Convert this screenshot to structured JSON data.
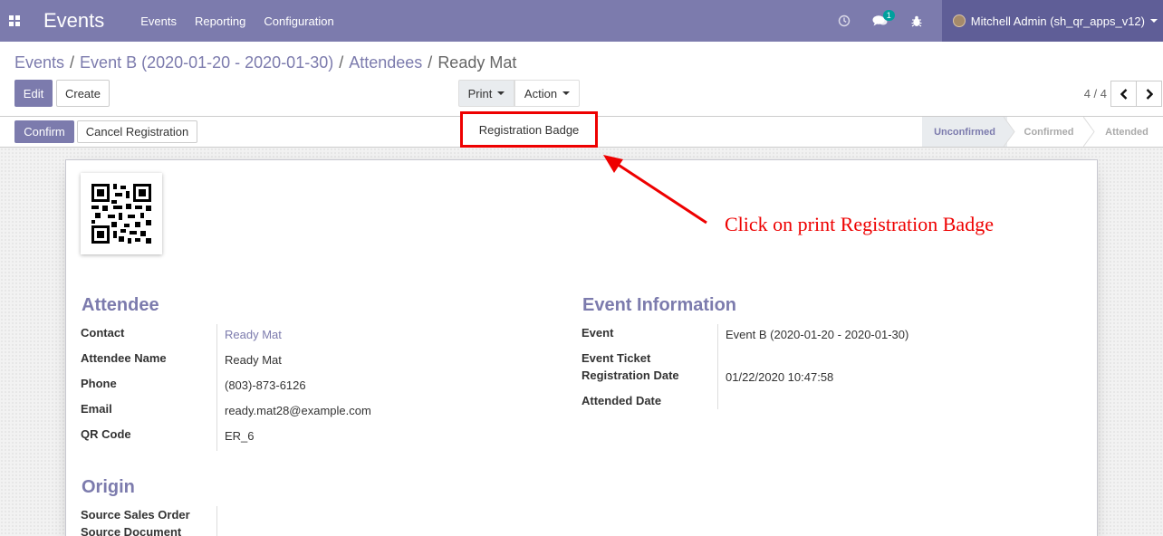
{
  "navbar": {
    "brand": "Events",
    "menu": [
      "Events",
      "Reporting",
      "Configuration"
    ],
    "chat_count": "1",
    "user": "Mitchell Admin (sh_qr_apps_v12)",
    "accent": "#7c7bad"
  },
  "breadcrumb": {
    "items": [
      "Events",
      "Event B (2020-01-20 - 2020-01-30)",
      "Attendees"
    ],
    "current": "Ready Mat"
  },
  "toolbar": {
    "edit": "Edit",
    "create": "Create",
    "print": "Print",
    "action": "Action",
    "pager": "4 / 4"
  },
  "print_menu": {
    "item": "Registration Badge"
  },
  "statusbar": {
    "confirm": "Confirm",
    "cancel": "Cancel Registration",
    "stages": [
      "Unconfirmed",
      "Confirmed",
      "Attended"
    ],
    "current_stage": "Unconfirmed"
  },
  "attendee": {
    "title": "Attendee",
    "labels": [
      "Contact",
      "Attendee Name",
      "Phone",
      "Email",
      "QR Code"
    ],
    "values": [
      "Ready Mat",
      "Ready Mat",
      "(803)-873-6126",
      "ready.mat28@example.com",
      "ER_6"
    ]
  },
  "event_info": {
    "title": "Event Information",
    "labels": [
      "Event",
      "Event Ticket",
      "Registration Date",
      "Attended Date"
    ],
    "event": "Event B (2020-01-20 - 2020-01-30)",
    "registration_date": "01/22/2020 10:47:58"
  },
  "origin": {
    "title": "Origin",
    "labels": [
      "Source Sales Order",
      "Source Document"
    ]
  },
  "annotation": {
    "text": "Click on print Registration Badge",
    "color": "#ee0000"
  }
}
